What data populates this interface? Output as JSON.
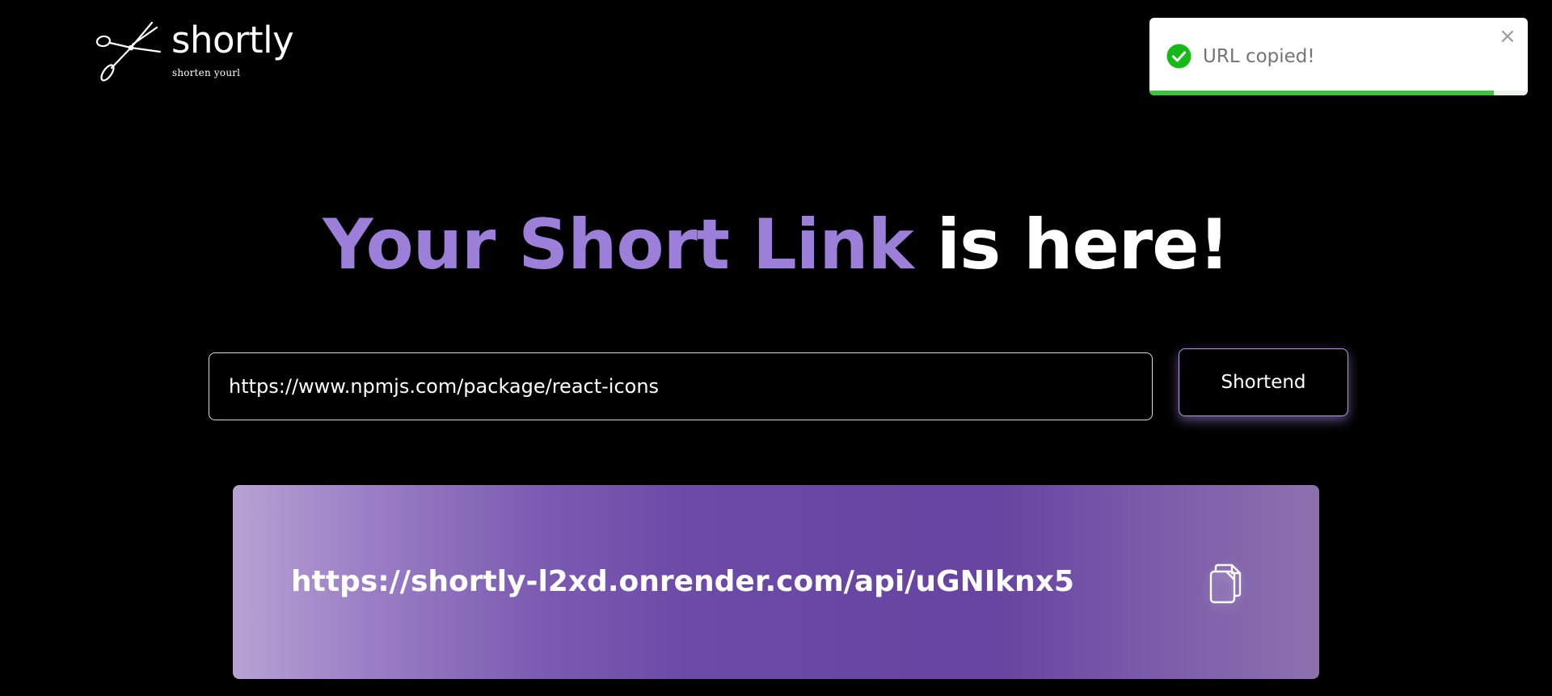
{
  "brand": {
    "name": "shortly",
    "tagline": "shorten yourl"
  },
  "toast": {
    "message": "URL copied!",
    "close_label": "×",
    "progress": 0.91,
    "status": "success",
    "accent_color": "#3fc23f"
  },
  "hero": {
    "accent_text": "Your Short Link",
    "plain_text": " is here!",
    "accent_color": "#9b7fd9"
  },
  "form": {
    "url_value": "https://www.npmjs.com/package/react-icons",
    "submit_label": "Shortend"
  },
  "result": {
    "short_url": "https://shortly-l2xd.onrender.com/api/uGNIknx5",
    "copy_icon": "copy-icon"
  }
}
